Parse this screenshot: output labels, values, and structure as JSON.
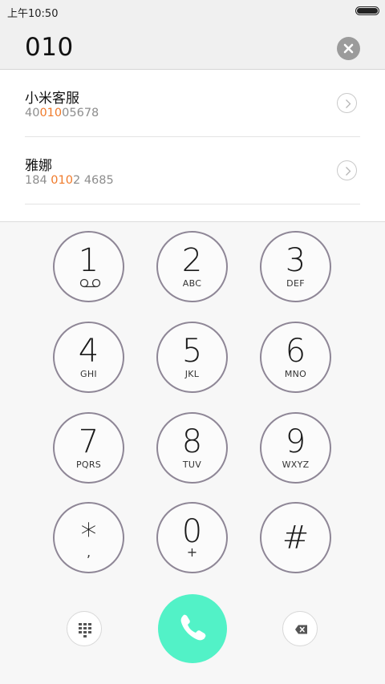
{
  "status_bar": {
    "time": "上午10:50"
  },
  "dialer": {
    "input": "010"
  },
  "results": [
    {
      "name": "小米客服",
      "number_pre": "40",
      "number_match": "010",
      "number_post": "05678"
    },
    {
      "name": "雅娜",
      "number_pre": "184 ",
      "number_match": "010",
      "number_post": "2 4685"
    }
  ],
  "keypad": {
    "k1": {
      "digit": "1",
      "letters": ""
    },
    "k2": {
      "digit": "2",
      "letters": "ABC"
    },
    "k3": {
      "digit": "3",
      "letters": "DEF"
    },
    "k4": {
      "digit": "4",
      "letters": "GHI"
    },
    "k5": {
      "digit": "5",
      "letters": "JKL"
    },
    "k6": {
      "digit": "6",
      "letters": "MNO"
    },
    "k7": {
      "digit": "7",
      "letters": "PQRS"
    },
    "k8": {
      "digit": "8",
      "letters": "TUV"
    },
    "k9": {
      "digit": "9",
      "letters": "WXYZ"
    },
    "kstar": {
      "digit": "*",
      "letters": ","
    },
    "k0": {
      "digit": "0",
      "letters": "+"
    },
    "khash": {
      "digit": "#",
      "letters": ""
    }
  },
  "icons": {
    "voicemail": "voicemail-icon",
    "clear": "clear-x-icon",
    "detail": "chevron-right-icon",
    "dialpad": "dialpad-icon",
    "call": "phone-icon",
    "backspace": "backspace-icon"
  },
  "colors": {
    "highlight": "#f07a2a",
    "call_button": "#52f2c7",
    "key_ring": "#8e8696"
  }
}
